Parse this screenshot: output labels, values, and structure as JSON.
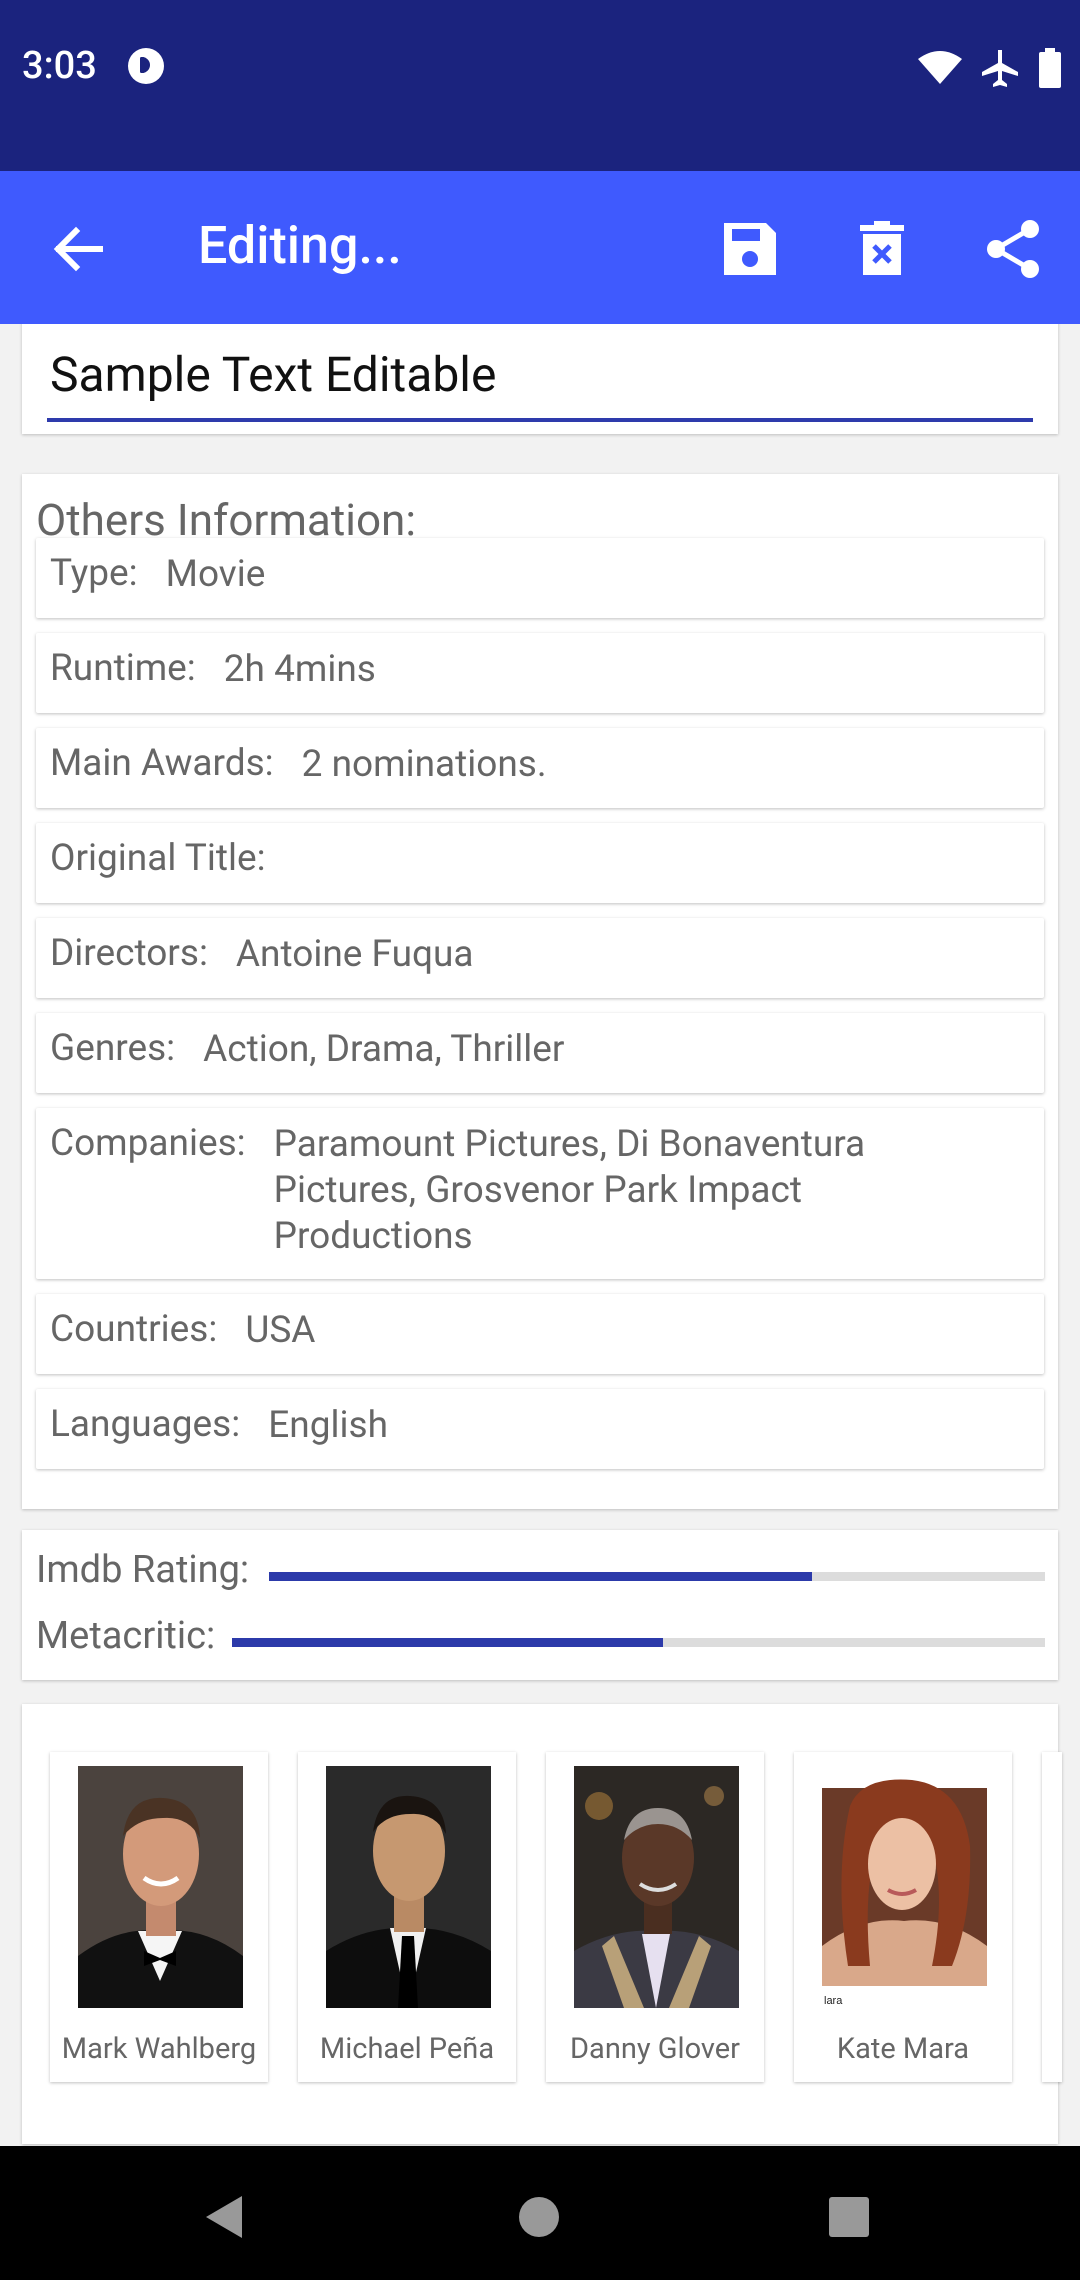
{
  "status_bar": {
    "time": "3:03",
    "icons": [
      "app-notification-icon",
      "wifi-icon",
      "airplane-icon",
      "battery-icon"
    ]
  },
  "app_bar": {
    "title": "Editing...",
    "actions": [
      "save-icon",
      "delete-icon",
      "share-icon"
    ],
    "color": "#3f5afe"
  },
  "title_field": {
    "value": "Sample Text Editable"
  },
  "info": {
    "heading": "Others Information:",
    "rows": [
      {
        "label": "Type:",
        "value": "Movie"
      },
      {
        "label": "Runtime:",
        "value": "2h 4mins"
      },
      {
        "label": "Main Awards:",
        "value": "2 nominations."
      },
      {
        "label": "Original Title:",
        "value": ""
      },
      {
        "label": "Directors:",
        "value": "Antoine Fuqua"
      },
      {
        "label": "Genres:",
        "value": "Action, Drama, Thriller"
      },
      {
        "label": "Companies:",
        "value": "Paramount Pictures, Di Bonaventura Pictures, Grosvenor Park Impact Productions"
      },
      {
        "label": "Countries:",
        "value": "USA"
      },
      {
        "label": "Languages:",
        "value": "English"
      }
    ]
  },
  "ratings": {
    "imdb": {
      "label": "Imdb Rating:",
      "fraction": 0.7
    },
    "metacritic": {
      "label": "Metacritic:",
      "fraction": 0.53
    }
  },
  "cast": [
    {
      "name": "Mark Wahlberg"
    },
    {
      "name": "Michael Peña"
    },
    {
      "name": "Danny Glover"
    },
    {
      "name": "Kate Mara"
    }
  ],
  "nav_bar": {
    "icons": [
      "back-triangle-icon",
      "home-circle-icon",
      "recents-square-icon"
    ]
  }
}
